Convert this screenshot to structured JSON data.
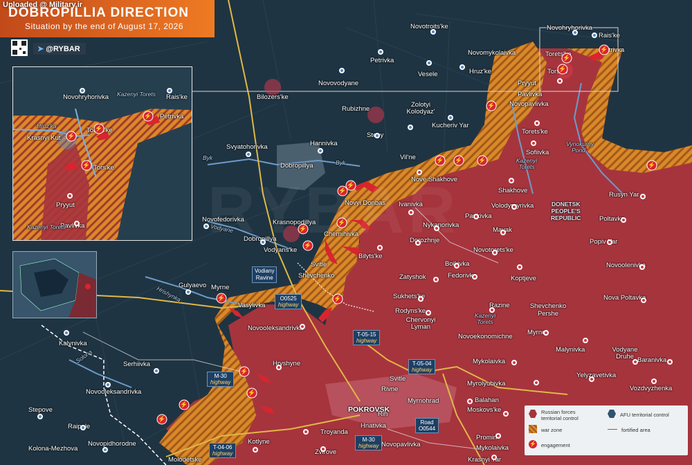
{
  "uploaded_by": "Uploaded @ Military.ir",
  "title": "DOBROPILLIA DIRECTION",
  "subtitle": "Situation by the end of August 17, 2026",
  "brand": "@RYBAR",
  "watermark": "RYBAR",
  "colors": {
    "russian": "#a6343d",
    "warzone": "#d9892a",
    "ukrainian": "#1f3442",
    "engagement": "#d8252e"
  },
  "legend": {
    "russian": "Russian forces territorial control",
    "afu": "AFU territorial control",
    "war_zone": "war zone",
    "fortified": "fortified area",
    "engagement": "engagement"
  },
  "region_label": [
    "DONETSK",
    "PEOPLE'S",
    "REPUBLIC"
  ],
  "inset": {
    "places": [
      "Novohryhorivka",
      "Rais'ke",
      "Petrivka",
      "Krasnyi Kut",
      "Torets'ke",
      "Tors'ke",
      "Pryyut",
      "Pavlivka"
    ],
    "rivers": [
      "Kazenyi Torets",
      "Hruz'ka",
      "Kazenyi Torets"
    ]
  },
  "places": {
    "novotroitske": "Novotroits'ke",
    "novohryhorivka": "Novohryhorivka",
    "raiske": "Rais'ke",
    "petrivka_n": "Petrivka",
    "novomykolaivka": "Novomykolaivka",
    "toretske": "Torets'ke",
    "hruzke": "Hruz'ke",
    "veselе": "Vesele",
    "petrivka_m": "Petrivka",
    "novovodyane": "Novovodyane",
    "bilozerske": "Bilozers'ke",
    "torske": "Tors'ke",
    "pryyut": "Pryyut",
    "pavlivka": "Pavlivka",
    "novopavlivka": "Novopavlivka",
    "zolotyi": "Zolotyi Kolodyaz'",
    "kucheriv": "Kucheriv Yar",
    "rubizhne": "Rubizhne",
    "stepy": "Stepy",
    "toretske2": "Torets'ke",
    "sofiivka": "Sofiivka",
    "svyatohorivka": "Svyatohorivka",
    "hannivka": "Hannivka",
    "dobropillya": "Dobropillya",
    "vilne": "Vil'ne",
    "nove_shakhove": "Nove Shakhove",
    "shakhove": "Shakhove",
    "rusyn_yar": "Rusyn Yar",
    "novyi_donbas": "Novyi Donbas",
    "ivanivka": "Ivanivka",
    "volodymyrivka": "Volodymyrivka",
    "pankivka": "Pankivka",
    "poltavka": "Poltavka",
    "novofedorivka": "Novofedorivka",
    "krasnopodillya": "Krasnopodillya",
    "nykanorivka": "Nykanorivka",
    "mayak": "Mayak",
    "popiv_yar": "Popiv Yar",
    "dobropillya2": "Dobropillya",
    "chernihivka": "Chernihivka",
    "dorozhnje": "Dorozhnje",
    "vodyanske": "Vodyans'ke",
    "bilytske": "Bilyts'ke",
    "novotoretske": "Novotorets'ke",
    "svitle": "Svitle",
    "shevchenko": "Shevchenko",
    "boikivka": "Boikivka",
    "novoolenivka": "Novoolenivka",
    "zatyshok": "Zatyshok",
    "fedorivka": "Fedorivka",
    "koptjeve": "Koptjeve",
    "gulyaevo": "Gulyaevo",
    "myrne": "Myrne",
    "sukhetske": "Sukhets'ke",
    "nova_poltavka": "Nova Poltavka",
    "vasylivka": "Vasylivka",
    "rodynske": "Rodyns'ke",
    "razine": "Razine",
    "chervonyi": "Chervonyi Lyman",
    "shevchenko_pershe": "Shevchenko Pershe",
    "novooleksandrivka": "Novooleksandrivka",
    "myrne2": "Myrne",
    "novoekonomichne": "Novoekonomichne",
    "kalynivka": "Kalynivka",
    "malynivka": "Malynivka",
    "vodyane_druhe": "Vodyane Druhe",
    "baranivka": "Baranivka",
    "serhiivka": "Serhiivka",
    "hryshyne": "Hryshyne",
    "mykolaivka": "Mykolaivka",
    "yelyzavetivka": "Yelyzavetivka",
    "novooleksandrivka2": "Novooleksandrivka",
    "svitle2": "Svitle",
    "myrolyubivka": "Myrolyubivka",
    "vozdvyzhenka": "Vozdvyzhenka",
    "rivne": "Rivne",
    "myrnohrad": "Myrnohrad",
    "stepove": "Stepove",
    "balahan": "Balahan",
    "pokrovsk": "POKROVSK",
    "moskovske": "Moskovs'ke",
    "rih": "Rih",
    "raipole": "Raipole",
    "hnatívka": "Hnativka",
    "novopidhorodne": "Novopidhorodne",
    "troyanda": "Troyanda",
    "promin": "Promin'",
    "kolona": "Kolona-Mezhova",
    "kotlyne": "Kotlyne",
    "novopavlivka2": "Novopavlivka",
    "mykolaivka2": "Mykolaivka",
    "zvirove": "Zvirove",
    "molodetske": "Molodetske",
    "krasnyi_yar": "Krasnyi Yar"
  },
  "rivers": {
    "byk_w": "Byk",
    "byk_e": "Byk",
    "vodyane": "Vodyane",
    "hrishynka": "Hrishynka",
    "kazenyi": "Kazenyi Torets",
    "kazenyi2": "Kazenyi Torets",
    "vynokurny": "Vynokurny Pond",
    "solona": "Solona"
  },
  "highways": {
    "o0525": {
      "code": "O0525",
      "type": "highway"
    },
    "t0515": {
      "code": "T-05-15",
      "type": "highway"
    },
    "t0504": {
      "code": "T-05-04",
      "type": "highway"
    },
    "m30a": {
      "code": "M-30",
      "type": "highway"
    },
    "m30b": {
      "code": "M-30",
      "type": "highway"
    },
    "o0544": {
      "code": "Road",
      "type": "O0544"
    },
    "t0406": {
      "code": "T-04-06",
      "type": "highway"
    }
  },
  "vodiany_ravine": [
    "Vodiany",
    "Ravine"
  ]
}
